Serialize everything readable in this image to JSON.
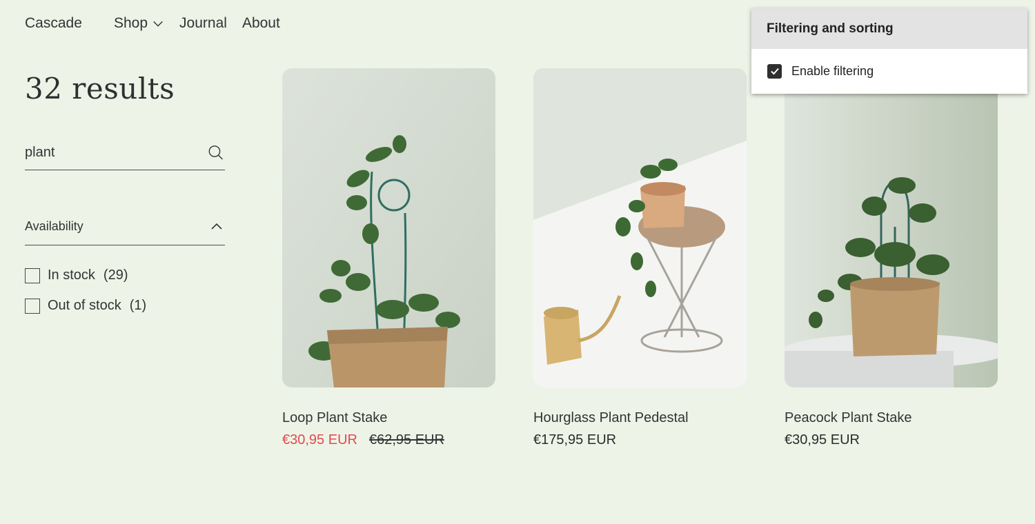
{
  "header": {
    "brand": "Cascade",
    "nav": [
      {
        "label": "Shop",
        "has_dropdown": true
      },
      {
        "label": "Journal"
      },
      {
        "label": "About"
      }
    ]
  },
  "sidebar": {
    "results_title": "32 results",
    "search": {
      "value": "plant",
      "icon": "search-icon"
    },
    "filter": {
      "title": "Availability",
      "expanded": true,
      "options": [
        {
          "label": "In stock",
          "count": "(29)",
          "checked": false
        },
        {
          "label": "Out of stock",
          "count": "(1)",
          "checked": false
        }
      ]
    }
  },
  "products": [
    {
      "title": "Loop Plant Stake",
      "sale_price": "€30,95 EUR",
      "original_price": "€62,95 EUR"
    },
    {
      "title": "Hourglass Plant Pedestal",
      "price": "€175,95 EUR"
    },
    {
      "title": "Peacock Plant Stake",
      "price": "€30,95 EUR"
    }
  ],
  "popup": {
    "title": "Filtering and sorting",
    "option_label": "Enable filtering",
    "option_checked": true
  },
  "colors": {
    "background": "#eef3e8",
    "sale_price": "#e24b4b",
    "text": "#333333"
  }
}
